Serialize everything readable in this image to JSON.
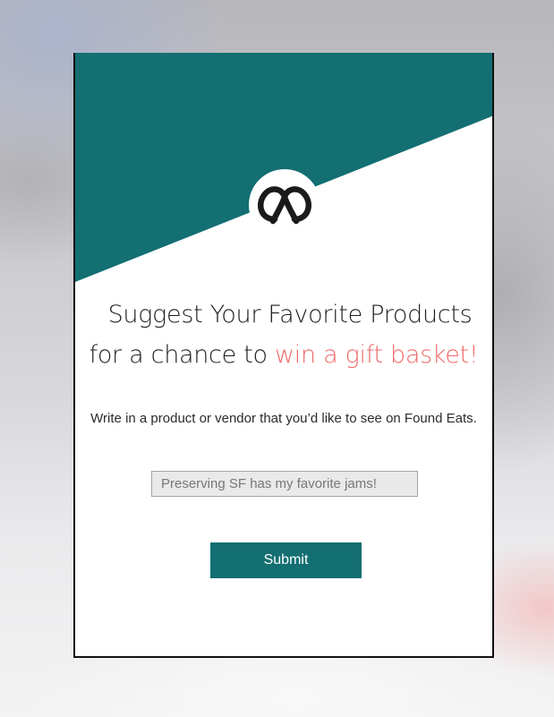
{
  "colors": {
    "accent_teal": "#136f72",
    "highlight_coral": "#ee6a6a",
    "text_dark": "#1e1e1e"
  },
  "header": {
    "logo_icon": "pretzel-icon"
  },
  "headline": {
    "line1": "Suggest Your Favorite Products",
    "line2_prefix": "for a chance to ",
    "line2_highlight": "win a gift basket",
    "line2_suffix": "!"
  },
  "description": "Write in a product or vendor that you’d like to see on Found Eats.",
  "suggestion_input": {
    "placeholder": "Preserving SF has my favorite jams!"
  },
  "submit": {
    "label": "Submit"
  }
}
